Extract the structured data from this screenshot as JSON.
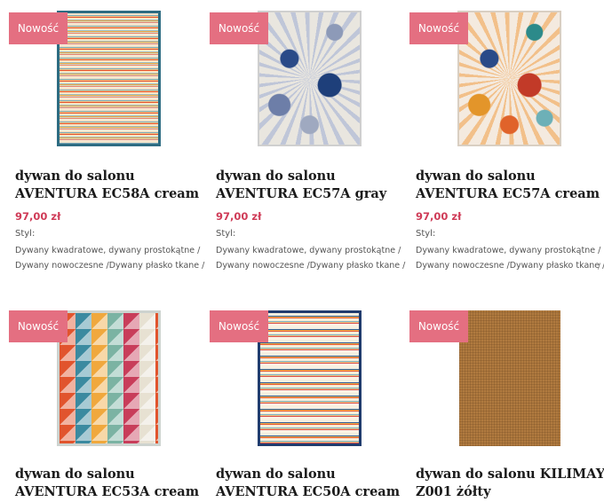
{
  "badge_label": "Nowość",
  "products": [
    {
      "title_line1": "dywan do salonu",
      "title_line2": "AVENTURA EC58A cream",
      "price": "97,00 zł",
      "style_label": "Styl:",
      "categories_line1": "Dywany kwadratowe, dywany prostokątne /",
      "categories_line2": "Dywany nowoczesne /Dywany płasko tkane /"
    },
    {
      "title_line1": "dywan do salonu",
      "title_line2": "AVENTURA EC57A gray",
      "price": "97,00 zł",
      "style_label": "Styl:",
      "categories_line1": "Dywany kwadratowe, dywany prostokątne /",
      "categories_line2": "Dywany nowoczesne /Dywany płasko tkane /"
    },
    {
      "title_line1": "dywan do salonu",
      "title_line2": "AVENTURA EC57A cream",
      "price": "97,00 zł",
      "style_label": "Styl:",
      "categories_line1": "Dywany kwadratowe, dywany prostokątne /",
      "categories_line2": "Dywany nowoczesne /Dywany płasko tkane /"
    },
    {
      "title_line1": "dywan do salonu",
      "title_line2": "AVENTURA EC53A cream"
    },
    {
      "title_line1": "dywan do salonu",
      "title_line2": "AVENTURA EC50A cream"
    },
    {
      "title_line1": "dywan do salonu KILIMAY",
      "title_line2": "Z001 żółty"
    }
  ],
  "colors": {
    "badge": "#e46f81",
    "price": "#cf3b57"
  }
}
